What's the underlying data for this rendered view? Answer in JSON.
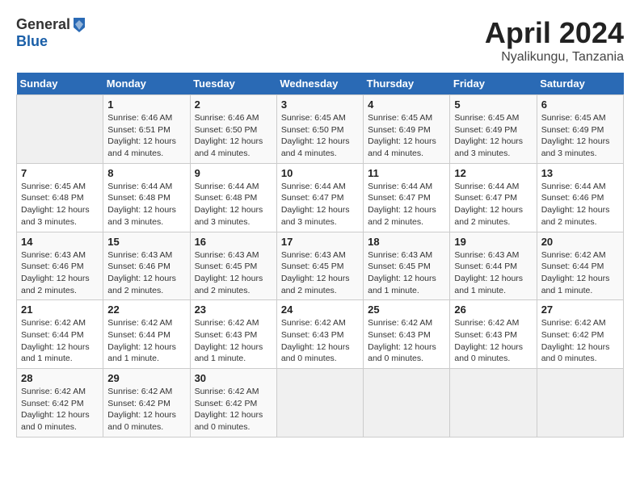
{
  "header": {
    "logo_general": "General",
    "logo_blue": "Blue",
    "title": "April 2024",
    "location": "Nyalikungu, Tanzania"
  },
  "calendar": {
    "days_of_week": [
      "Sunday",
      "Monday",
      "Tuesday",
      "Wednesday",
      "Thursday",
      "Friday",
      "Saturday"
    ],
    "weeks": [
      [
        {
          "day": "",
          "sunrise": "",
          "sunset": "",
          "daylight": ""
        },
        {
          "day": "1",
          "sunrise": "Sunrise: 6:46 AM",
          "sunset": "Sunset: 6:51 PM",
          "daylight": "Daylight: 12 hours and 4 minutes."
        },
        {
          "day": "2",
          "sunrise": "Sunrise: 6:46 AM",
          "sunset": "Sunset: 6:50 PM",
          "daylight": "Daylight: 12 hours and 4 minutes."
        },
        {
          "day": "3",
          "sunrise": "Sunrise: 6:45 AM",
          "sunset": "Sunset: 6:50 PM",
          "daylight": "Daylight: 12 hours and 4 minutes."
        },
        {
          "day": "4",
          "sunrise": "Sunrise: 6:45 AM",
          "sunset": "Sunset: 6:49 PM",
          "daylight": "Daylight: 12 hours and 4 minutes."
        },
        {
          "day": "5",
          "sunrise": "Sunrise: 6:45 AM",
          "sunset": "Sunset: 6:49 PM",
          "daylight": "Daylight: 12 hours and 3 minutes."
        },
        {
          "day": "6",
          "sunrise": "Sunrise: 6:45 AM",
          "sunset": "Sunset: 6:49 PM",
          "daylight": "Daylight: 12 hours and 3 minutes."
        }
      ],
      [
        {
          "day": "7",
          "sunrise": "Sunrise: 6:45 AM",
          "sunset": "Sunset: 6:48 PM",
          "daylight": "Daylight: 12 hours and 3 minutes."
        },
        {
          "day": "8",
          "sunrise": "Sunrise: 6:44 AM",
          "sunset": "Sunset: 6:48 PM",
          "daylight": "Daylight: 12 hours and 3 minutes."
        },
        {
          "day": "9",
          "sunrise": "Sunrise: 6:44 AM",
          "sunset": "Sunset: 6:48 PM",
          "daylight": "Daylight: 12 hours and 3 minutes."
        },
        {
          "day": "10",
          "sunrise": "Sunrise: 6:44 AM",
          "sunset": "Sunset: 6:47 PM",
          "daylight": "Daylight: 12 hours and 3 minutes."
        },
        {
          "day": "11",
          "sunrise": "Sunrise: 6:44 AM",
          "sunset": "Sunset: 6:47 PM",
          "daylight": "Daylight: 12 hours and 2 minutes."
        },
        {
          "day": "12",
          "sunrise": "Sunrise: 6:44 AM",
          "sunset": "Sunset: 6:47 PM",
          "daylight": "Daylight: 12 hours and 2 minutes."
        },
        {
          "day": "13",
          "sunrise": "Sunrise: 6:44 AM",
          "sunset": "Sunset: 6:46 PM",
          "daylight": "Daylight: 12 hours and 2 minutes."
        }
      ],
      [
        {
          "day": "14",
          "sunrise": "Sunrise: 6:43 AM",
          "sunset": "Sunset: 6:46 PM",
          "daylight": "Daylight: 12 hours and 2 minutes."
        },
        {
          "day": "15",
          "sunrise": "Sunrise: 6:43 AM",
          "sunset": "Sunset: 6:46 PM",
          "daylight": "Daylight: 12 hours and 2 minutes."
        },
        {
          "day": "16",
          "sunrise": "Sunrise: 6:43 AM",
          "sunset": "Sunset: 6:45 PM",
          "daylight": "Daylight: 12 hours and 2 minutes."
        },
        {
          "day": "17",
          "sunrise": "Sunrise: 6:43 AM",
          "sunset": "Sunset: 6:45 PM",
          "daylight": "Daylight: 12 hours and 2 minutes."
        },
        {
          "day": "18",
          "sunrise": "Sunrise: 6:43 AM",
          "sunset": "Sunset: 6:45 PM",
          "daylight": "Daylight: 12 hours and 1 minute."
        },
        {
          "day": "19",
          "sunrise": "Sunrise: 6:43 AM",
          "sunset": "Sunset: 6:44 PM",
          "daylight": "Daylight: 12 hours and 1 minute."
        },
        {
          "day": "20",
          "sunrise": "Sunrise: 6:42 AM",
          "sunset": "Sunset: 6:44 PM",
          "daylight": "Daylight: 12 hours and 1 minute."
        }
      ],
      [
        {
          "day": "21",
          "sunrise": "Sunrise: 6:42 AM",
          "sunset": "Sunset: 6:44 PM",
          "daylight": "Daylight: 12 hours and 1 minute."
        },
        {
          "day": "22",
          "sunrise": "Sunrise: 6:42 AM",
          "sunset": "Sunset: 6:44 PM",
          "daylight": "Daylight: 12 hours and 1 minute."
        },
        {
          "day": "23",
          "sunrise": "Sunrise: 6:42 AM",
          "sunset": "Sunset: 6:43 PM",
          "daylight": "Daylight: 12 hours and 1 minute."
        },
        {
          "day": "24",
          "sunrise": "Sunrise: 6:42 AM",
          "sunset": "Sunset: 6:43 PM",
          "daylight": "Daylight: 12 hours and 0 minutes."
        },
        {
          "day": "25",
          "sunrise": "Sunrise: 6:42 AM",
          "sunset": "Sunset: 6:43 PM",
          "daylight": "Daylight: 12 hours and 0 minutes."
        },
        {
          "day": "26",
          "sunrise": "Sunrise: 6:42 AM",
          "sunset": "Sunset: 6:43 PM",
          "daylight": "Daylight: 12 hours and 0 minutes."
        },
        {
          "day": "27",
          "sunrise": "Sunrise: 6:42 AM",
          "sunset": "Sunset: 6:42 PM",
          "daylight": "Daylight: 12 hours and 0 minutes."
        }
      ],
      [
        {
          "day": "28",
          "sunrise": "Sunrise: 6:42 AM",
          "sunset": "Sunset: 6:42 PM",
          "daylight": "Daylight: 12 hours and 0 minutes."
        },
        {
          "day": "29",
          "sunrise": "Sunrise: 6:42 AM",
          "sunset": "Sunset: 6:42 PM",
          "daylight": "Daylight: 12 hours and 0 minutes."
        },
        {
          "day": "30",
          "sunrise": "Sunrise: 6:42 AM",
          "sunset": "Sunset: 6:42 PM",
          "daylight": "Daylight: 12 hours and 0 minutes."
        },
        {
          "day": "",
          "sunrise": "",
          "sunset": "",
          "daylight": ""
        },
        {
          "day": "",
          "sunrise": "",
          "sunset": "",
          "daylight": ""
        },
        {
          "day": "",
          "sunrise": "",
          "sunset": "",
          "daylight": ""
        },
        {
          "day": "",
          "sunrise": "",
          "sunset": "",
          "daylight": ""
        }
      ]
    ]
  }
}
